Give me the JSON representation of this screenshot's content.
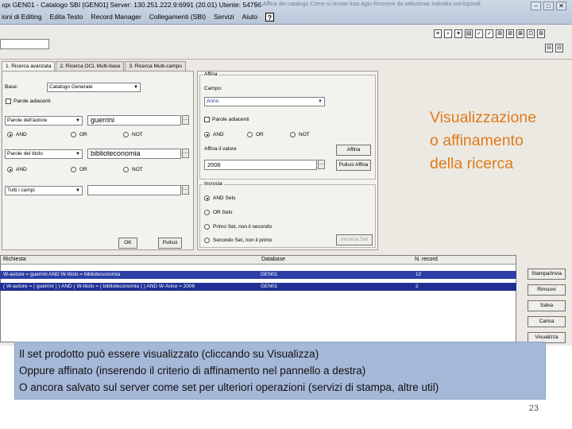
{
  "window": {
    "title": "ıqx GEN01 - Catalogo SBI [GEN01] Server: 130.251.222.9:6991 (20.01) Utente: 54796",
    "ghost_title": "Art.Affina dei catalogo Come si rinviati lista Agio Ricevere da selezionar individui corrispondi",
    "min": "–",
    "max": "□",
    "close": "✕"
  },
  "menu": {
    "items": [
      "ioni di Editing",
      "Edita Testo",
      "Record Manager",
      "Collegamenti (SBI)",
      "Servizi",
      "Aiuto"
    ],
    "help": "?"
  },
  "toolbar": {
    "icons": [
      "≡",
      "⌕",
      "✦",
      "▤",
      "✓",
      "✓",
      "⊞",
      "⊞",
      "⊠",
      "⊡",
      "⊞"
    ],
    "right_icons": [
      "⊟",
      "⊟",
      "⊟"
    ]
  },
  "search": {
    "tabs": [
      "1. Ricerca avanzata",
      "2. Ricerca OCL Multi-base",
      "3. Ricerca Multi-campo"
    ],
    "base_label": "Base:",
    "base_value": "Catalogo Generale",
    "adjacent_label": "Parole adiacenti",
    "field1_select": "Parole dell'autore",
    "field1_value": "guerrini",
    "ops": [
      "AND",
      "OR",
      "NOT"
    ],
    "field2_select": "Parole del titolo",
    "field2_value": "biblioteconomia",
    "field3_select": "Tutti i campi",
    "field3_value": "",
    "ok": "OK",
    "clear": "Pulisci",
    "dots": "..."
  },
  "affina": {
    "title": "Affina",
    "campo_label": "Campo:",
    "campo_value": "Anno",
    "adjacent_label": "Parole adiacenti",
    "ops": [
      "AND",
      "OR",
      "NOT"
    ],
    "value_label": "Affina il valore",
    "value": "2006",
    "button": "Affina",
    "clear_button": "Pulisci Affina",
    "sets_title": "Incrocia",
    "sets": [
      "AND Sets",
      "OR Sets",
      "Primo Set, non il secondo",
      "Secondo Set, non il primo"
    ],
    "sets_button": "Incrocia Set"
  },
  "results": {
    "headers": [
      "Richiesta",
      "Database",
      "N. record"
    ],
    "rows": [
      {
        "query": "W-autore = guerrini AND W-titolo = biblioteconomia",
        "db": "GEN01",
        "count": "12"
      },
      {
        "query": "( W-autore = ( guerrini ) ) AND ( W-titolo = ( biblioteconomia ) ) AND W-Anno = 2006",
        "db": "GEN01",
        "count": "2"
      }
    ],
    "buttons": [
      "Stampa/Invia",
      "Rimuovi",
      "Salva",
      "Carica",
      "Visualizza"
    ]
  },
  "annotation": {
    "orange_lines": [
      "Visualizzazione",
      "o affinamento",
      "della ricerca"
    ],
    "callout_lines": [
      "Il set prodotto può essere visualizzato (cliccando su Visualizza)",
      "Oppure affinato (inserendo il criterio di affinamento nel pannello a destra)",
      "O ancora salvato sul server come set per ulteriori operazioni (servizi di stampa, altre util)"
    ],
    "page_number": "23"
  },
  "colors": {
    "selected_row": "#2c3fa6",
    "annotation_text": "#e07a1b",
    "callout_bg": "#a6b8d8"
  }
}
